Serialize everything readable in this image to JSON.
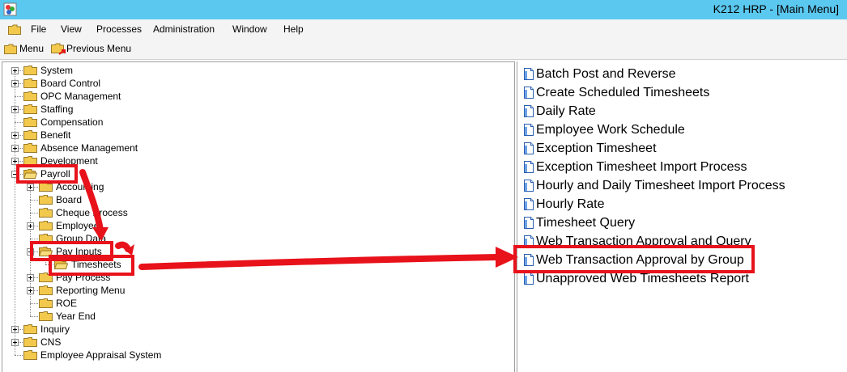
{
  "window": {
    "title": "K212 HRP - [Main Menu]"
  },
  "menubar": {
    "items": [
      "File",
      "View",
      "Processes",
      "Administration",
      "Window",
      "Help"
    ]
  },
  "toolbar": {
    "menu_label": "Menu",
    "previous_menu_label": "Previous Menu"
  },
  "tree": {
    "items": [
      {
        "label": "System",
        "expandable": true
      },
      {
        "label": "Board Control",
        "expandable": true
      },
      {
        "label": "OPC Management",
        "expandable": false
      },
      {
        "label": "Staffing",
        "expandable": true
      },
      {
        "label": "Compensation",
        "expandable": false
      },
      {
        "label": "Benefit",
        "expandable": true
      },
      {
        "label": "Absence Management",
        "expandable": true
      },
      {
        "label": "Development",
        "expandable": true
      },
      {
        "label": "Payroll",
        "expandable": true,
        "expanded": true
      },
      {
        "label": "Accounting",
        "expandable": true
      },
      {
        "label": "Board",
        "expandable": false
      },
      {
        "label": "Cheque Process",
        "expandable": false
      },
      {
        "label": "Employee",
        "expandable": true
      },
      {
        "label": "Group Data",
        "expandable": false
      },
      {
        "label": "Pay Inputs",
        "expandable": true,
        "expanded": true
      },
      {
        "label": "Timesheets",
        "expandable": false,
        "selected": true
      },
      {
        "label": "Pay Process",
        "expandable": true
      },
      {
        "label": "Reporting Menu",
        "expandable": true
      },
      {
        "label": "ROE",
        "expandable": false
      },
      {
        "label": "Year End",
        "expandable": false
      },
      {
        "label": "Inquiry",
        "expandable": true
      },
      {
        "label": "CNS",
        "expandable": true
      },
      {
        "label": "Employee Appraisal System",
        "expandable": false
      }
    ]
  },
  "list": {
    "items": [
      "Batch Post and Reverse",
      "Create Scheduled Timesheets",
      "Daily Rate",
      "Employee Work Schedule",
      "Exception Timesheet",
      "Exception Timesheet Import Process",
      "Hourly and Daily Timesheet Import Process",
      "Hourly Rate",
      "Timesheet Query",
      "Web Transaction Approval and Query",
      "Web Transaction Approval by Group",
      "Unapproved Web Timesheets Report"
    ]
  },
  "colors": {
    "titlebar": "#5bc8f0",
    "annotation": "#e8121b",
    "folder": "#f2c94c"
  }
}
